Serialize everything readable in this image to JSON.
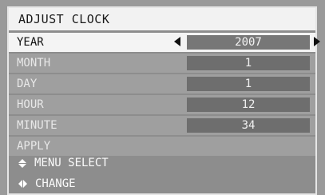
{
  "title": "ADJUST CLOCK",
  "rows": [
    {
      "label": "YEAR",
      "value": "2007",
      "selected": true
    },
    {
      "label": "MONTH",
      "value": "1"
    },
    {
      "label": "DAY",
      "value": "1"
    },
    {
      "label": "HOUR",
      "value": "12"
    },
    {
      "label": "MINUTE",
      "value": "34"
    },
    {
      "label": "APPLY"
    }
  ],
  "hints": {
    "menu_select": "MENU SELECT",
    "change": "CHANGE"
  },
  "icons": {
    "left_arrow": "triangle-left-icon",
    "right_arrow": "triangle-right-icon",
    "up_down": "up-down-arrows-icon",
    "left_right": "left-right-arrows-icon"
  }
}
